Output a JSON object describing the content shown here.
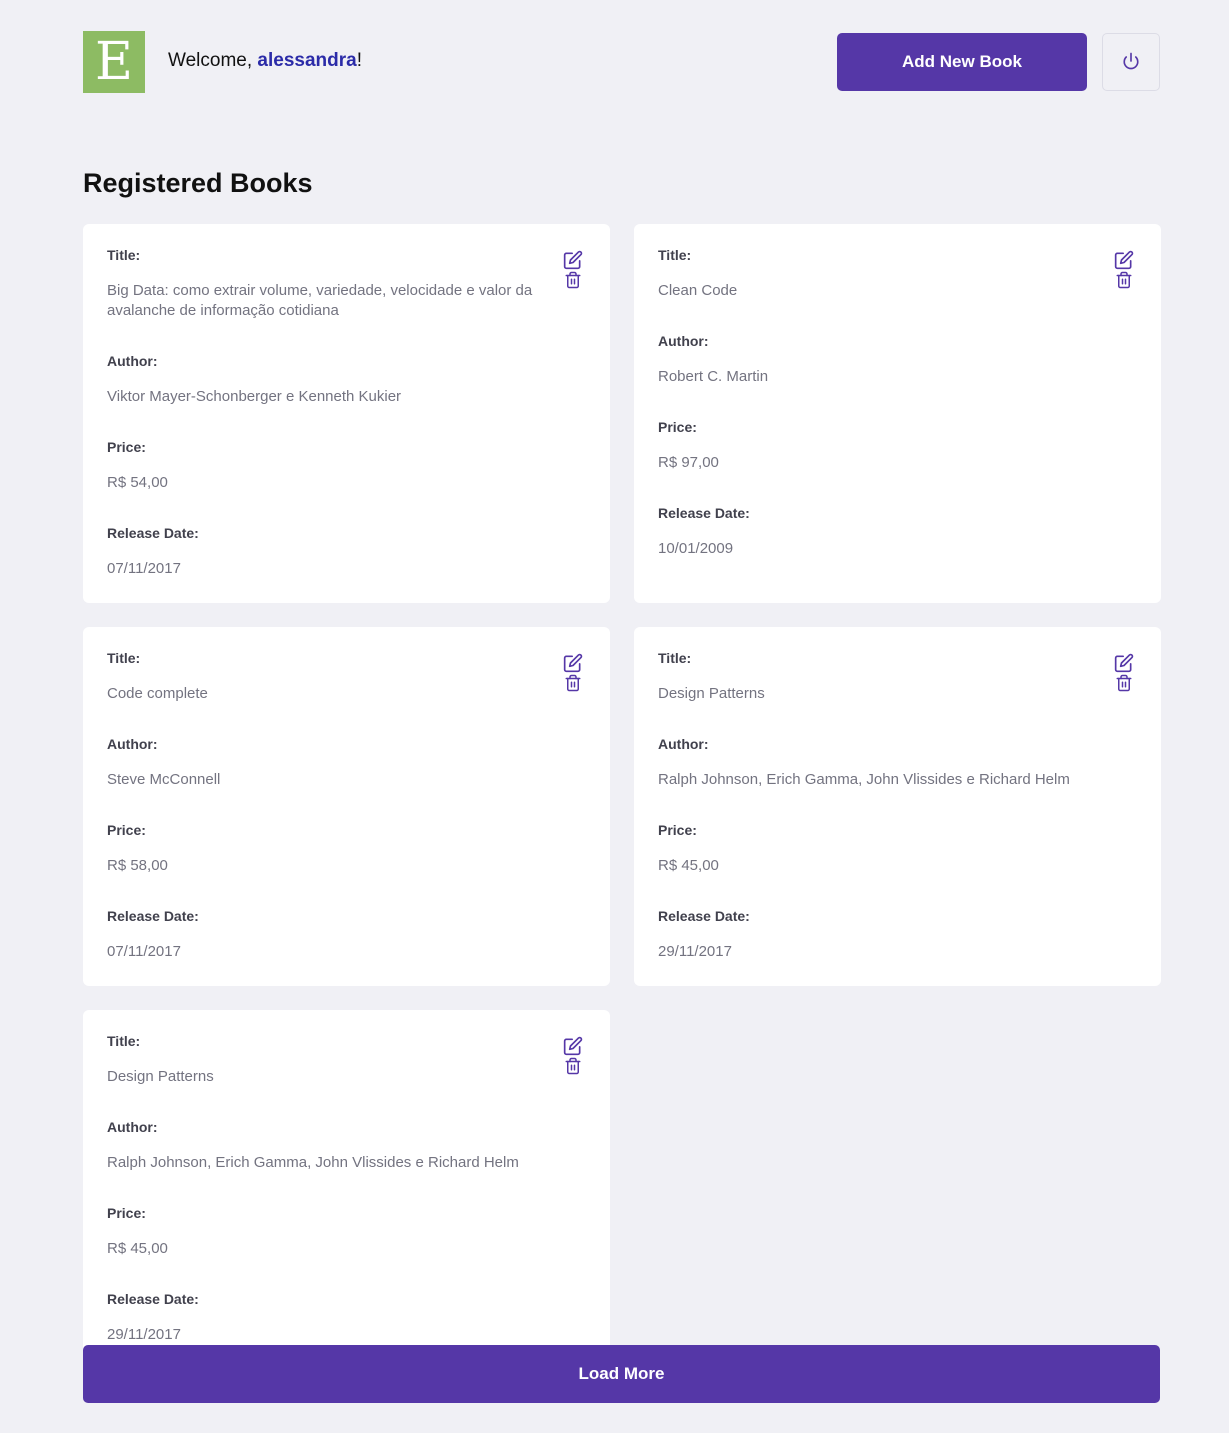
{
  "header": {
    "logo_letter": "E",
    "welcome_prefix": "Welcome, ",
    "username": "alessandra",
    "welcome_suffix": "!",
    "add_button_label": "Add New Book",
    "logout_icon": "power-icon"
  },
  "section": {
    "title": "Registered Books"
  },
  "labels": {
    "title": "Title:",
    "author": "Author:",
    "price": "Price:",
    "release_date": "Release Date:"
  },
  "books": [
    {
      "title": "Big Data: como extrair volume, variedade, velocidade e valor da avalanche de informação cotidiana",
      "author": "Viktor Mayer-Schonberger e Kenneth Kukier",
      "price": "R$ 54,00",
      "release_date": "07/11/2017"
    },
    {
      "title": "Clean Code",
      "author": "Robert C. Martin",
      "price": "R$ 97,00",
      "release_date": "10/01/2009"
    },
    {
      "title": "Code complete",
      "author": "Steve McConnell",
      "price": "R$ 58,00",
      "release_date": "07/11/2017"
    },
    {
      "title": "Design Patterns",
      "author": "Ralph Johnson, Erich Gamma, John Vlissides e Richard Helm",
      "price": "R$ 45,00",
      "release_date": "29/11/2017"
    },
    {
      "title": "Design Patterns",
      "author": "Ralph Johnson, Erich Gamma, John Vlissides e Richard Helm",
      "price": "R$ 45,00",
      "release_date": "29/11/2017"
    }
  ],
  "icons": {
    "edit": "edit-icon",
    "delete": "trash-icon"
  },
  "load_more_label": "Load More",
  "colors": {
    "background": "#f0f0f5",
    "primary": "#5537a7",
    "username": "#2b2ba8",
    "logo": "#8dbb63",
    "icon": "#5537a7"
  }
}
